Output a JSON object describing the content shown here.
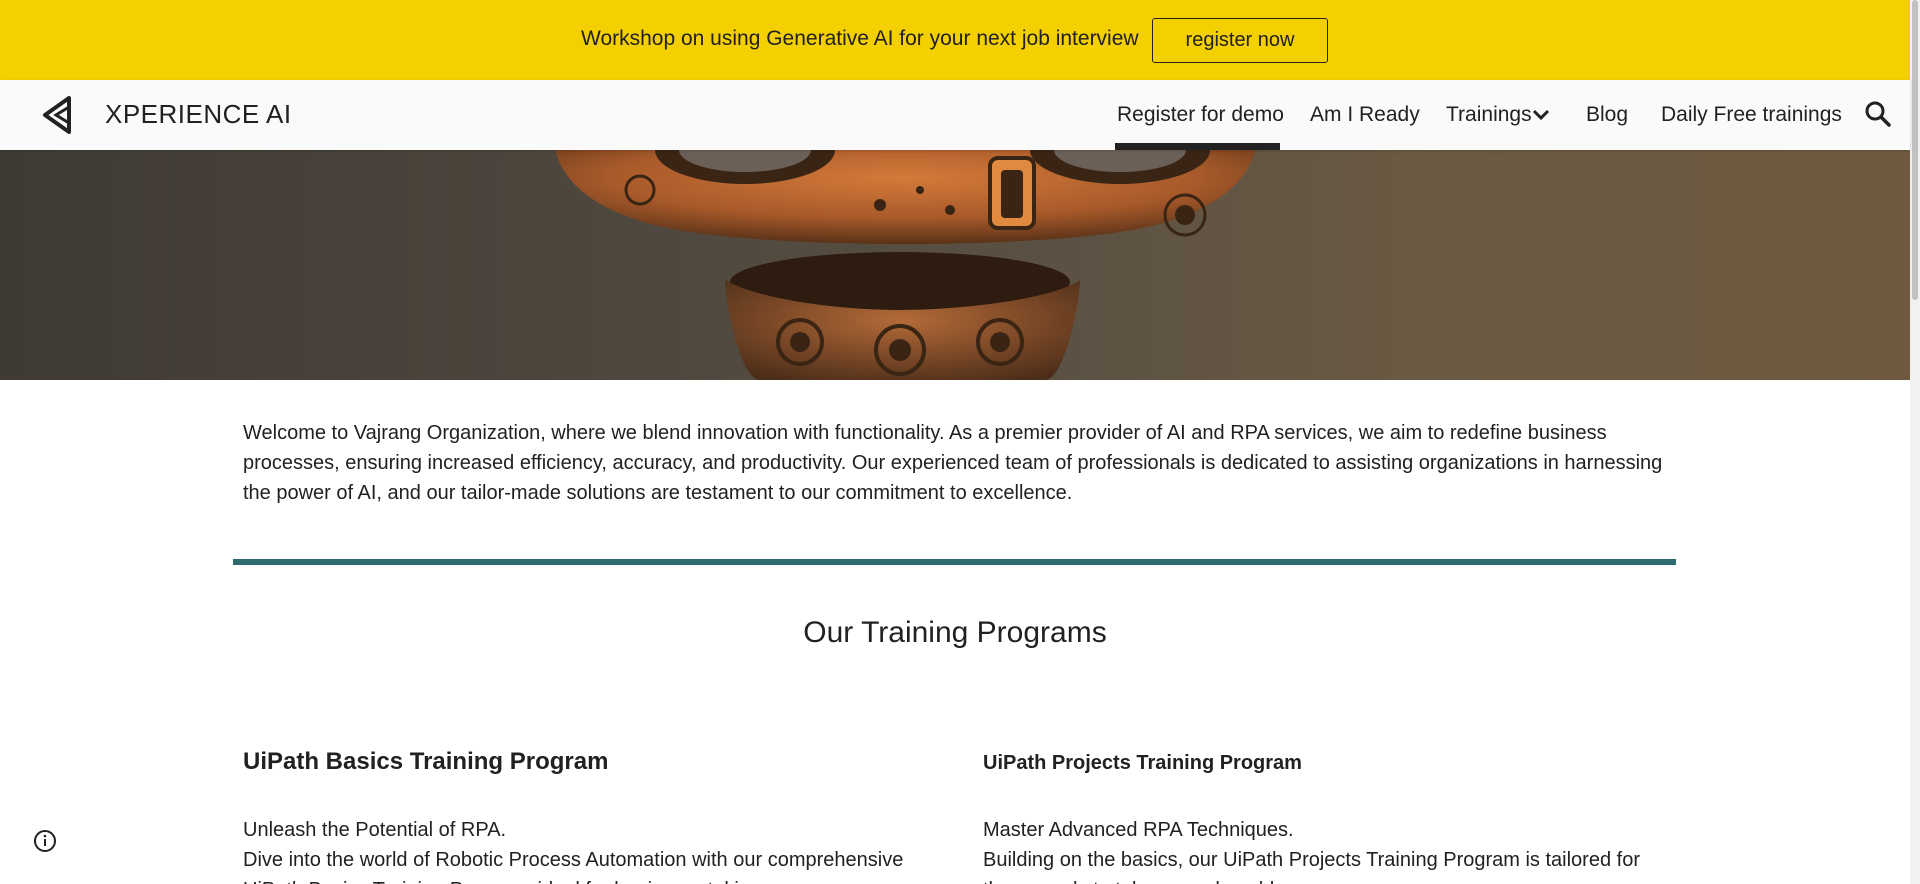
{
  "banner": {
    "text": "Workshop on using Generative AI for your next job interview",
    "button_label": "register now",
    "background_color": "#f5d000"
  },
  "header": {
    "brand": "XPERIENCE AI",
    "logo_icon": "xperience-logo-icon",
    "nav": [
      {
        "label": "Register for demo",
        "active": true
      },
      {
        "label": "Am I Ready"
      },
      {
        "label": "Trainings",
        "has_dropdown": true,
        "icon": "chevron-down-icon"
      },
      {
        "label": "Blog"
      },
      {
        "label": "Daily Free trainings"
      }
    ],
    "search_icon": "search-icon"
  },
  "hero": {
    "image": "robot-hero-image"
  },
  "intro": {
    "text": "Welcome to Vajrang Organization, where we blend innovation with functionality. As a premier provider of AI and RPA services, we aim to redefine business processes, ensuring increased efficiency, accuracy, and productivity. Our experienced team of professionals is dedicated to assisting organizations in harnessing the power of AI, and our tailor-made solutions are testament to our commitment to excellence."
  },
  "divider_color": "#2e6b6e",
  "programs": {
    "title": "Our Training Programs",
    "items": [
      {
        "title": "UiPath Basics Training Program",
        "tagline": "Unleash the Potential of RPA.",
        "description": "Dive into the world of Robotic Process Automation with our comprehensive UiPath Basics Training Program, ideal for beginners taking"
      },
      {
        "title": "UiPath Projects Training Program",
        "tagline": "Master Advanced RPA Techniques.",
        "description": "Building on the basics, our UiPath Projects Training Program is tailored for those ready to take on real-world"
      }
    ]
  },
  "info_icon": "info-icon"
}
